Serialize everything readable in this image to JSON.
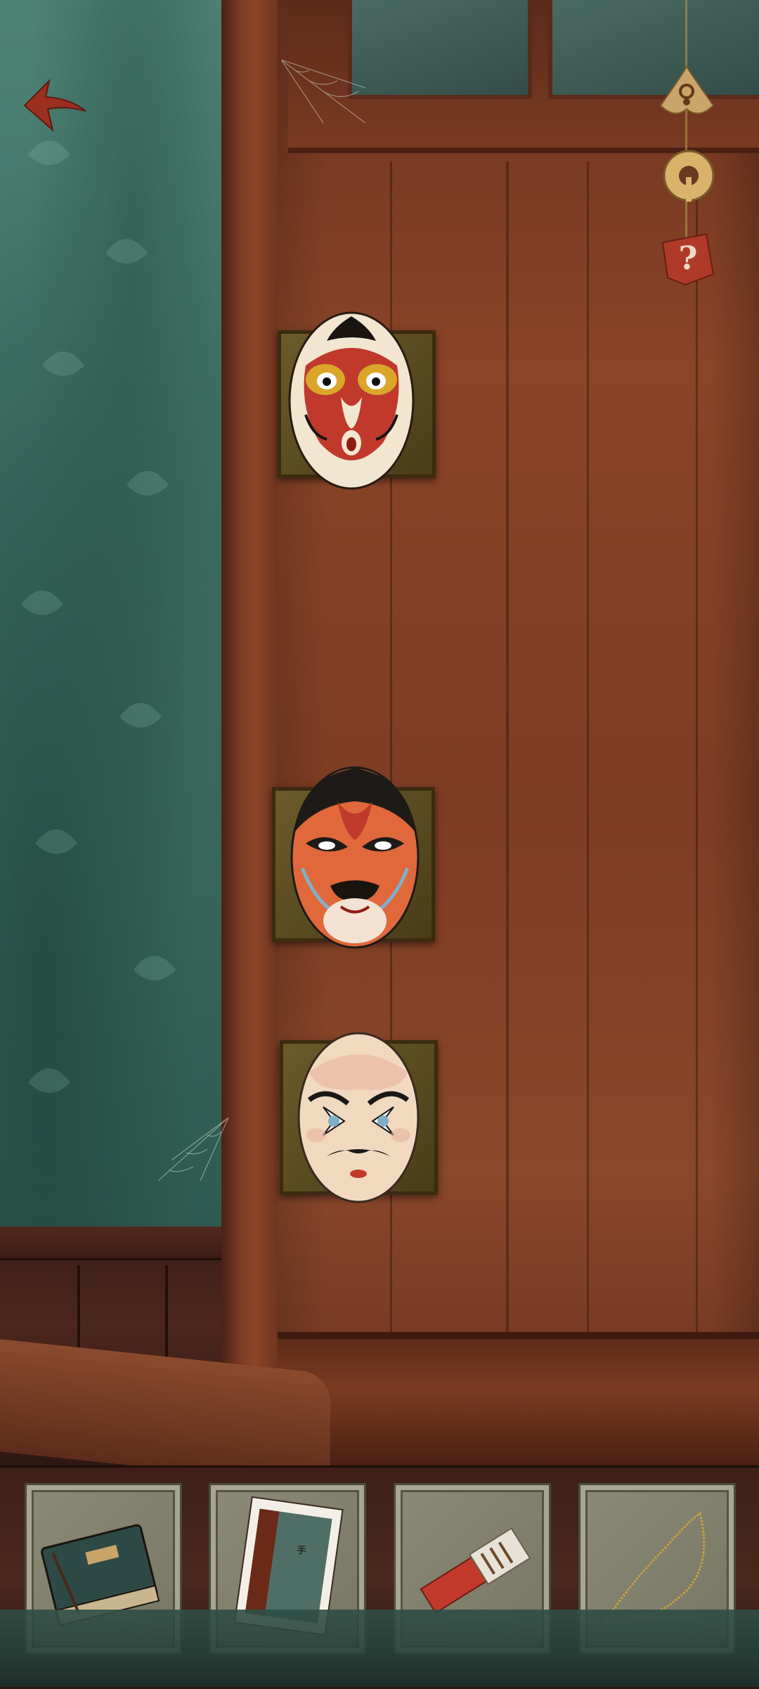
{
  "app": {
    "name": "opera-mask-door-puzzle"
  },
  "hud": {
    "back_icon": "back-arrow-icon",
    "buttons": [
      {
        "name": "hint-button",
        "icon": "hint-ornament-icon"
      },
      {
        "name": "settings-button",
        "icon": "coin-ring-icon"
      },
      {
        "name": "help-button",
        "icon": "question-mark-icon"
      }
    ]
  },
  "scene": {
    "masks": [
      {
        "name": "monkey-king-mask",
        "colors": {
          "base": "#f2e6d0",
          "accent": "#c0392b",
          "eye": "#d9a62a"
        }
      },
      {
        "name": "red-face-mask",
        "colors": {
          "base": "#e0683a",
          "accent": "#1d1a17",
          "beard": "#1a1410"
        }
      },
      {
        "name": "clown-mask",
        "colors": {
          "base": "#f1d9c0",
          "accent": "#1b1715",
          "blush": "#e8b4a0"
        }
      }
    ]
  },
  "inventory": {
    "items": [
      {
        "name": "old-book",
        "icon": "book-icon"
      },
      {
        "name": "photo-card",
        "icon": "photo-icon"
      },
      {
        "name": "matchbox",
        "icon": "matchbox-icon"
      },
      {
        "name": "necklace",
        "icon": "necklace-icon"
      }
    ]
  },
  "colors": {
    "wall": "#4f8376",
    "door": "#8a4428",
    "hud_gold": "#d9b36a",
    "help_red": "#b03a2a",
    "inventory_slot": "#8b8a76"
  }
}
